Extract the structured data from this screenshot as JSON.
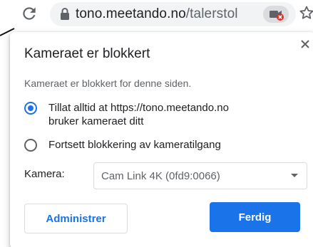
{
  "browser": {
    "url_host": "tono.meetando.no",
    "url_path": "/talerstol",
    "icons": {
      "reload": "reload-icon",
      "lock": "lock-icon",
      "camera_blocked": "camera-blocked-icon",
      "bookmark": "star-icon"
    }
  },
  "popup": {
    "title": "Kameraet er blokkert",
    "subtitle": "Kameraet er blokkert for denne siden.",
    "options": [
      {
        "label_line1": "Tillat alltid at https://tono.meetando.no",
        "label_line2": "bruker kameraet ditt",
        "selected": true
      },
      {
        "label_line1": "Fortsett blokkering av kameratilgang",
        "label_line2": "",
        "selected": false
      }
    ],
    "camera_label": "Kamera:",
    "camera_select_value": "Cam Link 4K (0fd9:0066)",
    "manage_button": "Administrer",
    "done_button": "Ferdig"
  },
  "colors": {
    "accent": "#1a73e8",
    "text": "#202124",
    "secondary_text": "#5f6368",
    "blocked_badge": "#d93025"
  }
}
